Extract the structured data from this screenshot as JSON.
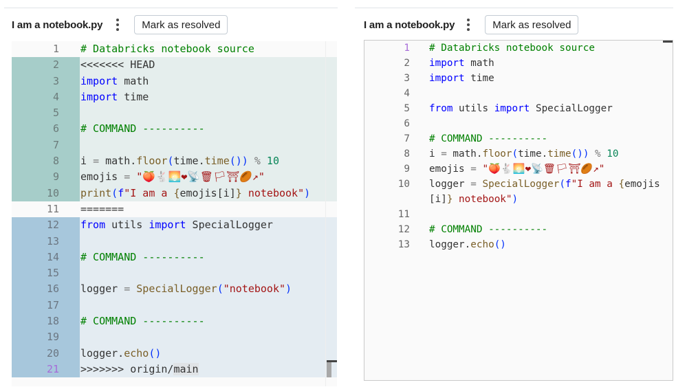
{
  "left": {
    "title": "I am a notebook.py",
    "mark_resolved_label": "Mark as resolved",
    "lines": [
      {
        "n": "1",
        "sec": "plain",
        "t": [
          [
            "cm",
            "# Databricks notebook source"
          ]
        ]
      },
      {
        "n": "2",
        "sec": "head",
        "t": [
          [
            "",
            "<<<<<<< HEAD"
          ]
        ]
      },
      {
        "n": "3",
        "sec": "head",
        "t": [
          [
            "kw",
            "import"
          ],
          [
            "",
            " math"
          ]
        ]
      },
      {
        "n": "4",
        "sec": "head",
        "t": [
          [
            "kw",
            "import"
          ],
          [
            "",
            " time"
          ]
        ]
      },
      {
        "n": "5",
        "sec": "head",
        "t": []
      },
      {
        "n": "6",
        "sec": "head",
        "t": [
          [
            "cm",
            "# COMMAND ----------"
          ]
        ]
      },
      {
        "n": "7",
        "sec": "head",
        "t": []
      },
      {
        "n": "8",
        "sec": "head",
        "t": [
          [
            "",
            "i "
          ],
          [
            "op",
            "="
          ],
          [
            "",
            " math."
          ],
          [
            "fn",
            "floor"
          ],
          [
            "br",
            "("
          ],
          [
            "",
            "time."
          ],
          [
            "fn",
            "time"
          ],
          [
            "br",
            "())"
          ],
          [
            "op",
            " %"
          ],
          [
            "nu",
            " 10"
          ]
        ]
      },
      {
        "n": "9",
        "sec": "head",
        "t": [
          [
            "",
            "emojis "
          ],
          [
            "op",
            "="
          ],
          [
            "st",
            " \"🍑🐇🌅❤📡🗑🏳⛩🏉↗\""
          ]
        ]
      },
      {
        "n": "10",
        "sec": "head",
        "t": [
          [
            "fn",
            "print"
          ],
          [
            "br",
            "("
          ],
          [
            "kw",
            "f"
          ],
          [
            "st",
            "\"I am a "
          ],
          [
            "fn",
            "{"
          ],
          [
            "",
            "emojis[i]"
          ],
          [
            "fn",
            "}"
          ],
          [
            "st",
            " notebook\""
          ],
          [
            "br",
            ")"
          ]
        ]
      },
      {
        "n": "11",
        "sec": "plain",
        "t": [
          [
            "",
            "======="
          ]
        ]
      },
      {
        "n": "12",
        "sec": "orig",
        "t": [
          [
            "kw",
            "from"
          ],
          [
            "",
            " utils "
          ],
          [
            "kw",
            "import"
          ],
          [
            "",
            " SpecialLogger"
          ]
        ]
      },
      {
        "n": "13",
        "sec": "orig",
        "t": []
      },
      {
        "n": "14",
        "sec": "orig",
        "t": [
          [
            "cm",
            "# COMMAND ----------"
          ]
        ]
      },
      {
        "n": "15",
        "sec": "orig",
        "t": []
      },
      {
        "n": "16",
        "sec": "orig",
        "t": [
          [
            "",
            "logger "
          ],
          [
            "op",
            "="
          ],
          [
            "",
            " "
          ],
          [
            "fn",
            "SpecialLogger"
          ],
          [
            "br",
            "("
          ],
          [
            "st",
            "\"notebook\""
          ],
          [
            "br",
            ")"
          ]
        ]
      },
      {
        "n": "17",
        "sec": "orig",
        "t": []
      },
      {
        "n": "18",
        "sec": "orig",
        "t": [
          [
            "cm",
            "# COMMAND ----------"
          ]
        ]
      },
      {
        "n": "19",
        "sec": "orig",
        "t": []
      },
      {
        "n": "20",
        "sec": "orig",
        "t": [
          [
            "",
            "logger."
          ],
          [
            "fn",
            "echo"
          ],
          [
            "br",
            "()"
          ]
        ]
      },
      {
        "n": "21",
        "sec": "orig",
        "cur": true,
        "t": [
          [
            "",
            ">>>>>>> origin/"
          ],
          [
            "sel",
            "main"
          ]
        ]
      }
    ]
  },
  "right": {
    "title": "I am a notebook.py",
    "mark_resolved_label": "Mark as resolved",
    "lines": [
      {
        "n": "1",
        "cur": true,
        "t": [
          [
            "cm",
            "# Databricks notebook source"
          ]
        ]
      },
      {
        "n": "2",
        "t": [
          [
            "kw",
            "import"
          ],
          [
            "",
            " math"
          ]
        ]
      },
      {
        "n": "3",
        "t": [
          [
            "kw",
            "import"
          ],
          [
            "",
            " time"
          ]
        ]
      },
      {
        "n": "4",
        "t": []
      },
      {
        "n": "5",
        "t": [
          [
            "kw",
            "from"
          ],
          [
            "",
            " utils "
          ],
          [
            "kw",
            "import"
          ],
          [
            "",
            " SpecialLogger"
          ]
        ]
      },
      {
        "n": "6",
        "t": []
      },
      {
        "n": "7",
        "t": [
          [
            "cm",
            "# COMMAND ----------"
          ]
        ]
      },
      {
        "n": "8",
        "t": [
          [
            "",
            "i "
          ],
          [
            "op",
            "="
          ],
          [
            "",
            " math."
          ],
          [
            "fn",
            "floor"
          ],
          [
            "br",
            "("
          ],
          [
            "",
            "time."
          ],
          [
            "fn",
            "time"
          ],
          [
            "br",
            "())"
          ],
          [
            "op",
            " %"
          ],
          [
            "nu",
            " 10"
          ]
        ]
      },
      {
        "n": "9",
        "t": [
          [
            "",
            "emojis "
          ],
          [
            "op",
            "="
          ],
          [
            "st",
            " \"🍑🐇🌅❤📡🗑🏳⛩🏉↗\""
          ]
        ]
      },
      {
        "n": "10",
        "t": [
          [
            "",
            "logger "
          ],
          [
            "op",
            "="
          ],
          [
            "",
            " "
          ],
          [
            "fn",
            "SpecialLogger"
          ],
          [
            "br",
            "("
          ],
          [
            "kw",
            "f"
          ],
          [
            "st",
            "\"I am a "
          ],
          [
            "fn",
            "{"
          ],
          [
            "",
            "emojis[i]"
          ],
          [
            "fn",
            "}"
          ],
          [
            "st",
            " notebook\""
          ],
          [
            "br",
            ")"
          ]
        ]
      },
      {
        "n": "11",
        "t": []
      },
      {
        "n": "12",
        "t": [
          [
            "cm",
            "# COMMAND ----------"
          ]
        ]
      },
      {
        "n": "13",
        "t": [
          [
            "",
            "logger."
          ],
          [
            "fn",
            "echo"
          ],
          [
            "br",
            "()"
          ]
        ]
      }
    ]
  },
  "colors": {
    "keyword": "#0000ff",
    "comment": "#008000",
    "function": "#795e26",
    "string": "#a31515",
    "number": "#098658",
    "head_gutter": "#a6cdc9",
    "origin_gutter": "#a7c7dc"
  }
}
